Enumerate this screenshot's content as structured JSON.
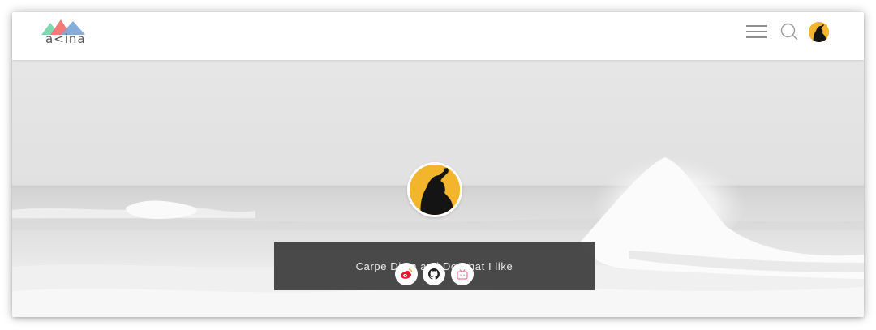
{
  "header": {
    "logo_text": "a<ina",
    "logo_colors": [
      "#7ed8b0",
      "#f27a78",
      "#7fa8d8"
    ],
    "icons": [
      "menu-icon",
      "search-icon",
      "avatar"
    ]
  },
  "hero": {
    "motto": "Carpe Diem and Do what I like",
    "avatar_color": "#f3b52b"
  },
  "social_links": [
    {
      "name": "weibo",
      "icon": "weibo-icon",
      "color": "#e6162d"
    },
    {
      "name": "github",
      "icon": "github-icon",
      "color": "#222222"
    },
    {
      "name": "bilibili",
      "icon": "bilibili-icon",
      "color": "#f07c9a"
    }
  ]
}
